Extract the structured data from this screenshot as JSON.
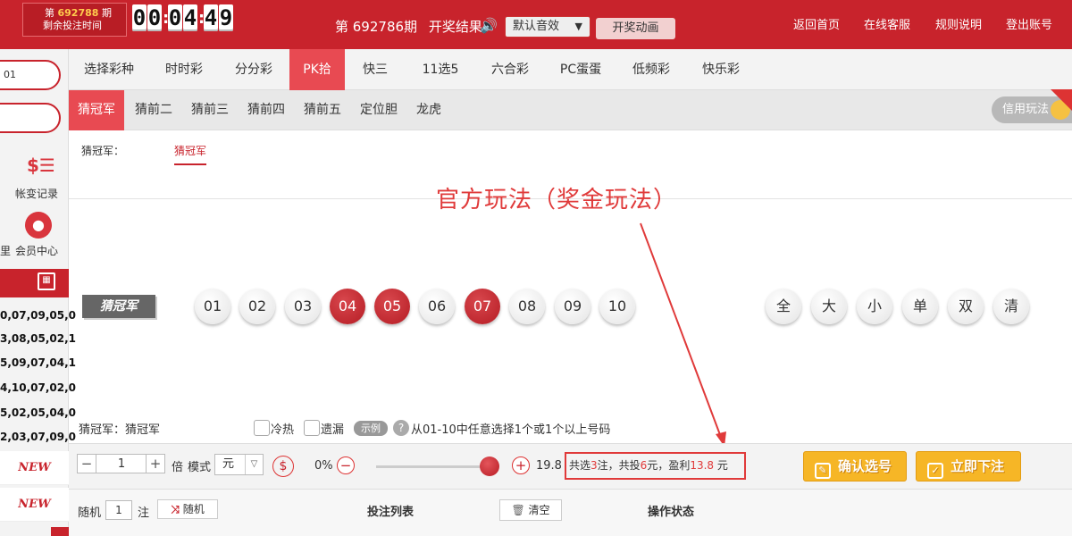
{
  "header": {
    "period_prefix": "第",
    "period_number": "692788",
    "period_suffix": "期",
    "remaining_label": "剩余投注时间",
    "countdown": [
      "0",
      "0",
      "0",
      "4",
      "4",
      "9"
    ],
    "current_period_text": "第 692786期",
    "result_label": "开奖结果",
    "sound_select": "默认音效",
    "animation_button": "开奖动画",
    "nav": [
      "返回首页",
      "在线客服",
      "规则说明",
      "登出账号"
    ]
  },
  "sidebar": {
    "pill1": "01",
    "pill2": "",
    "account_label": "帐变记录",
    "member_label": "会员中心",
    "left_fragment": "里",
    "results": [
      "0,07,09,05,0",
      "3,08,05,02,1",
      "5,09,07,04,1",
      "4,10,07,02,0",
      "5,02,05,04,0",
      "2,03,07,09,0"
    ],
    "new_badges": [
      "NEW",
      "NEW"
    ]
  },
  "lottery_tabs": [
    "选择彩种",
    "时时彩",
    "分分彩",
    "PK拾",
    "快三",
    "11选5",
    "六合彩",
    "PC蛋蛋",
    "低频彩",
    "快乐彩"
  ],
  "active_lottery": "PK拾",
  "play_tabs": [
    "猜冠军",
    "猜前二",
    "猜前三",
    "猜前四",
    "猜前五",
    "定位胆",
    "龙虎"
  ],
  "credit_toggle": "信用玩法",
  "selection": {
    "title": "猜冠军：",
    "option": "猜冠军"
  },
  "annotation": "官方玩法（奖金玩法）",
  "ball_row": {
    "label": "猜冠军",
    "balls": [
      "01",
      "02",
      "03",
      "04",
      "05",
      "06",
      "07",
      "08",
      "09",
      "10"
    ],
    "selected": [
      "04",
      "05",
      "07"
    ],
    "shortcuts": [
      "全",
      "大",
      "小",
      "单",
      "双",
      "清"
    ]
  },
  "info": {
    "play_name": "猜冠军：猜冠军",
    "hot": "冷热",
    "miss": "遗漏",
    "example": "示例",
    "hint": "从01-10中任意选择1个或1个以上号码"
  },
  "bet": {
    "multiplier": "1",
    "multiplier_unit": "倍",
    "mode_label": "模式",
    "unit": "元",
    "rebate_pct": "0%",
    "odds": "19.8",
    "summary_pre": "共选",
    "bets": "3",
    "summary_mid1": "注，共投",
    "amount": "6",
    "summary_mid2": "元，盈利",
    "profit": "13.8",
    "summary_end": " 元",
    "confirm": "确认选号",
    "place": "立即下注"
  },
  "bottom": {
    "random_label": "随机",
    "random_count": "1",
    "random_unit": "注",
    "random_button": "随机",
    "list_title": "投注列表",
    "clear_button": "清空",
    "status_title": "操作状态"
  }
}
